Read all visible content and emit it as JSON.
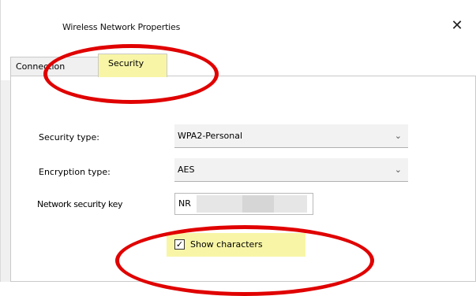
{
  "window": {
    "title": "Wireless Network Properties",
    "close_glyph": "✕"
  },
  "tabs": [
    {
      "label": "Connection",
      "active": false
    },
    {
      "label": "Security",
      "active": true
    }
  ],
  "form": {
    "security_type_label": "Security type:",
    "security_type_value": "WPA2-Personal",
    "encryption_type_label": "Encryption type:",
    "encryption_type_value": "AES",
    "network_key_label": "Network security key",
    "network_key_value": "NR",
    "show_characters_label": "Show characters",
    "show_characters_checked": true
  },
  "annotations": {
    "highlight_color": "#f8f6a6",
    "ring_color": "#e00000"
  },
  "icons": {
    "dropdown": "chevron-down-icon",
    "close": "close-icon",
    "checkbox": "checkbox-checked-icon"
  }
}
